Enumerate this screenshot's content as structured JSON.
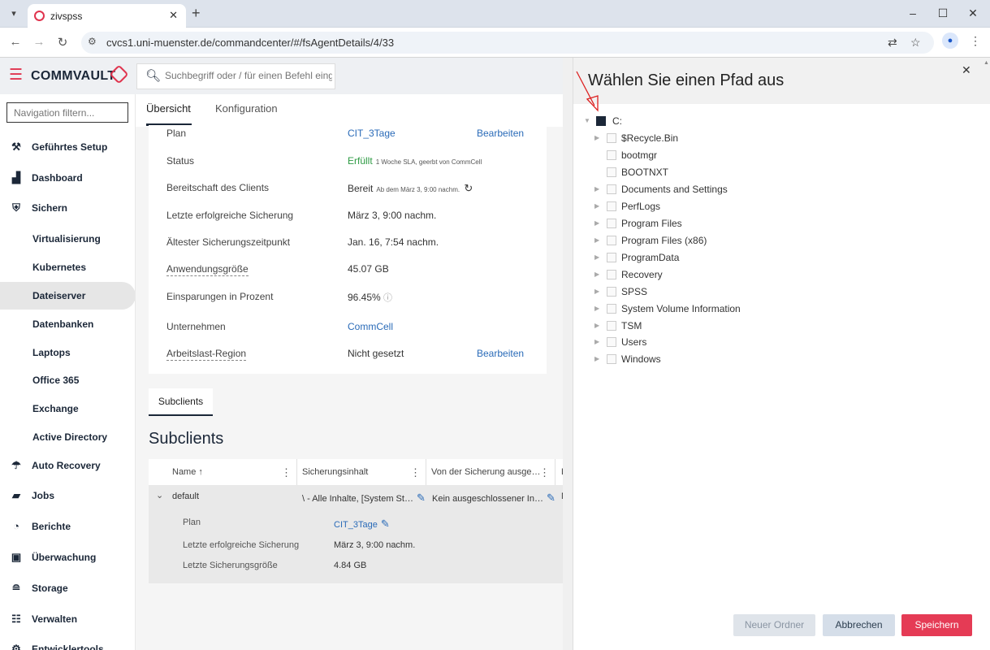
{
  "browser": {
    "tab_title": "zivspss",
    "url": "cvcs1.uni-muenster.de/commandcenter/#/fsAgentDetails/4/33",
    "window_controls": [
      "–",
      "☐",
      "✕"
    ]
  },
  "app": {
    "logo": "COMMVAULT",
    "search_placeholder": "Suchbegriff oder / für einen Befehl eingeben",
    "accent_color": "#e0344e"
  },
  "sidebar": {
    "filter_placeholder": "Navigation filtern...",
    "items": [
      {
        "label": "Geführtes Setup",
        "icon": "wrench-icon",
        "sub": false
      },
      {
        "label": "Dashboard",
        "icon": "dashboard-icon",
        "sub": false
      },
      {
        "label": "Sichern",
        "icon": "shield-icon",
        "sub": false
      },
      {
        "label": "Virtualisierung",
        "sub": true
      },
      {
        "label": "Kubernetes",
        "sub": true
      },
      {
        "label": "Dateiserver",
        "sub": true,
        "active": true
      },
      {
        "label": "Datenbanken",
        "sub": true
      },
      {
        "label": "Laptops",
        "sub": true
      },
      {
        "label": "Office 365",
        "sub": true
      },
      {
        "label": "Exchange",
        "sub": true
      },
      {
        "label": "Active Directory",
        "sub": true
      },
      {
        "label": "Auto Recovery",
        "icon": "recovery-icon",
        "sub": false
      },
      {
        "label": "Jobs",
        "icon": "briefcase-icon",
        "sub": false
      },
      {
        "label": "Berichte",
        "icon": "report-icon",
        "sub": false
      },
      {
        "label": "Überwachung",
        "icon": "monitor-icon",
        "sub": false
      },
      {
        "label": "Storage",
        "icon": "database-icon",
        "sub": false
      },
      {
        "label": "Verwalten",
        "icon": "sliders-icon",
        "sub": false
      },
      {
        "label": "Entwicklertools",
        "icon": "gear-icon",
        "sub": false
      }
    ]
  },
  "main": {
    "tabs": [
      "Übersicht",
      "Konfiguration"
    ],
    "overview": {
      "plan_label": "Plan",
      "plan_value": "CIT_3Tage",
      "plan_action": "Bearbeiten",
      "status_label": "Status",
      "status_value": "Erfüllt",
      "status_note": "1 Woche SLA, geerbt von CommCell",
      "readiness_label": "Bereitschaft des Clients",
      "readiness_value": "Bereit",
      "readiness_note": "Ab dem März 3, 9:00 nachm.",
      "last_backup_label": "Letzte erfolgreiche Sicherung",
      "last_backup_value": "März 3, 9:00 nachm.",
      "oldest_label": "Ältester Sicherungszeitpunkt",
      "oldest_value": "Jan. 16, 7:54 nachm.",
      "appsize_label": "Anwendungsgröße",
      "appsize_value": "45.07 GB",
      "savings_label": "Einsparungen in Prozent",
      "savings_value": "96.45%",
      "company_label": "Unternehmen",
      "company_value": "CommCell",
      "region_label": "Arbeitslast-Region",
      "region_value": "Nicht gesetzt",
      "region_action": "Bearbeiten"
    },
    "subclients_tab": "Subclients",
    "subclients_heading": "Subclients",
    "grid": {
      "columns": [
        "Name ↑",
        "Sicherungsinhalt",
        "Von der Sicherung ausge…",
        "L"
      ],
      "row": {
        "name": "default",
        "content": "\\ - Alle Inhalte, [System St…",
        "excluded": "Kein ausgeschlossener In…",
        "last": "N"
      },
      "details": {
        "plan_label": "Plan",
        "plan_value": "CIT_3Tage",
        "last_backup_label": "Letzte erfolgreiche Sicherung",
        "last_backup_value": "März 3, 9:00 nachm.",
        "size_label": "Letzte Sicherungsgröße",
        "size_value": "4.84 GB"
      }
    }
  },
  "dialog": {
    "title": "Wählen Sie einen Pfad aus",
    "root": "C:",
    "nodes": [
      {
        "label": "$Recycle.Bin",
        "expandable": true
      },
      {
        "label": "bootmgr",
        "expandable": false
      },
      {
        "label": "BOOTNXT",
        "expandable": false
      },
      {
        "label": "Documents and Settings",
        "expandable": true
      },
      {
        "label": "PerfLogs",
        "expandable": true
      },
      {
        "label": "Program Files",
        "expandable": true
      },
      {
        "label": "Program Files (x86)",
        "expandable": true
      },
      {
        "label": "ProgramData",
        "expandable": true
      },
      {
        "label": "Recovery",
        "expandable": true
      },
      {
        "label": "SPSS",
        "expandable": true
      },
      {
        "label": "System Volume Information",
        "expandable": true
      },
      {
        "label": "TSM",
        "expandable": true
      },
      {
        "label": "Users",
        "expandable": true
      },
      {
        "label": "Windows",
        "expandable": true
      }
    ],
    "buttons": {
      "new_folder": "Neuer Ordner",
      "cancel": "Abbrechen",
      "save": "Speichern"
    }
  }
}
